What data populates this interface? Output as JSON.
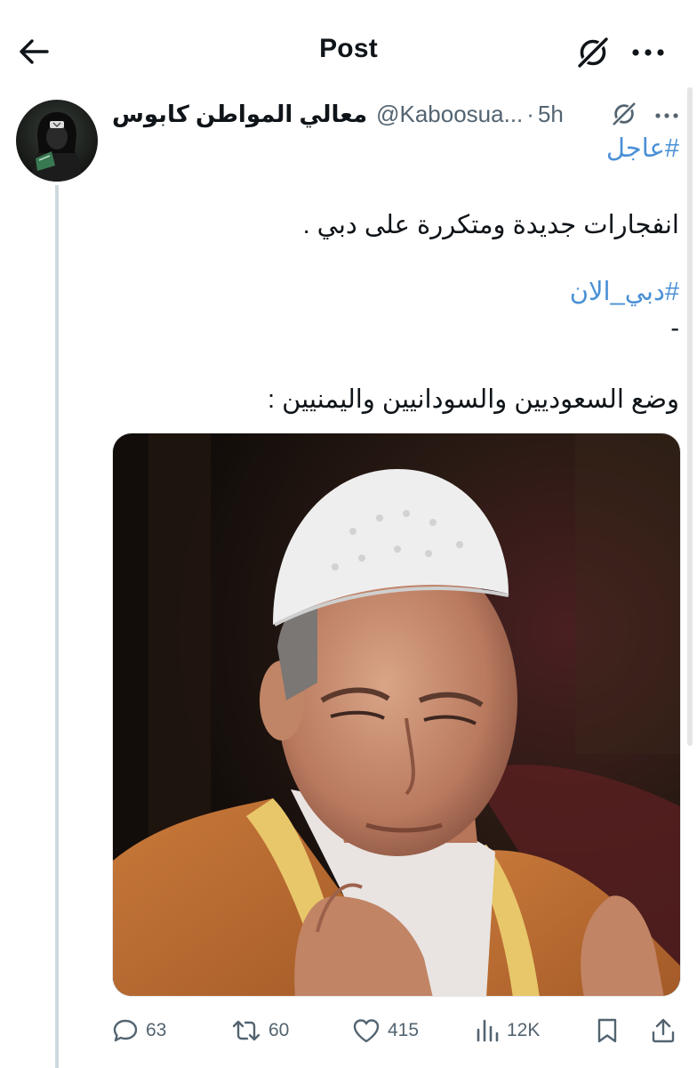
{
  "header": {
    "title": "Post",
    "back_icon": "arrow-left-icon",
    "grok_icon": "grok-icon",
    "more_icon": "more-horizontal-icon"
  },
  "tweet": {
    "display_name": "معالي المواطن كابوس",
    "handle": "@Kaboosua...",
    "separator": "·",
    "time": "5h",
    "lines": {
      "hashtag1": "#عاجل",
      "text1": "انفجارات جديدة ومتكررة على دبي .",
      "hashtag2": "#دبي_الان",
      "dash": "-",
      "text2": "وضع السعوديين والسودانيين واليمنيين :"
    },
    "media_alt": "photo",
    "stats": {
      "replies": "63",
      "reposts": "60",
      "likes": "415",
      "views": "12K"
    }
  },
  "colors": {
    "text": "#0f1419",
    "secondary": "#536471",
    "link": "#4a90d6",
    "divider": "#cfd9de"
  }
}
